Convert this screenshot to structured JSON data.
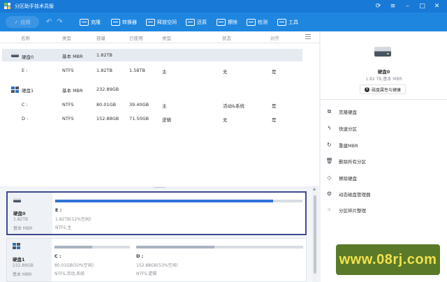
{
  "window": {
    "title": "分区助手技术员版"
  },
  "toolbar": {
    "apply_label": "应用",
    "tools": [
      {
        "label": "克隆",
        "icon": "clone-icon"
      },
      {
        "label": "转换器",
        "icon": "convert-icon"
      },
      {
        "label": "释放空间",
        "icon": "free-space-icon"
      },
      {
        "label": "还原",
        "icon": "restore-icon"
      },
      {
        "label": "擦除",
        "icon": "wipe-icon"
      },
      {
        "label": "检测",
        "icon": "check-icon"
      },
      {
        "label": "工具",
        "icon": "tools-icon"
      }
    ]
  },
  "table": {
    "headers": [
      "名称",
      "类型",
      "容量",
      "已使用",
      "类型",
      "状态",
      "对齐"
    ],
    "rows": [
      {
        "kind": "disk",
        "name": "硬盘0",
        "type": "基本 MBR",
        "capacity": "1.82TB",
        "used": "",
        "ptype": "",
        "status": "",
        "align": "",
        "selected": true
      },
      {
        "kind": "part",
        "name": "E :",
        "type": "NTFS",
        "capacity": "1.82TB",
        "used": "1.58TB",
        "ptype": "主",
        "status": "无",
        "align": "是"
      },
      {
        "kind": "disk2",
        "name": "硬盘1",
        "type": "基本 MBR",
        "capacity": "232.89GB",
        "used": "",
        "ptype": "",
        "status": "",
        "align": ""
      },
      {
        "kind": "part",
        "name": "C :",
        "type": "NTFS",
        "capacity": "80.01GB",
        "used": "39.40GB",
        "ptype": "主",
        "status": "活动&系统",
        "align": "是"
      },
      {
        "kind": "part",
        "name": "D :",
        "type": "NTFS",
        "capacity": "152.88GB",
        "used": "71.50GB",
        "ptype": "逻辑",
        "status": "无",
        "align": "是"
      }
    ]
  },
  "diskmap": {
    "disk0": {
      "name": "硬盘0",
      "size": "1.82TB",
      "type": "基本 MBR",
      "partitions": [
        {
          "label": "E :",
          "info1": "1.82TB(12%空闲)",
          "info2": "NTFS,主",
          "used_fraction": 0.88
        }
      ]
    },
    "disk1": {
      "name": "硬盘1",
      "size": "232.89GB",
      "type": "基本 MBR",
      "partitions": [
        {
          "label": "C :",
          "info1": "80.01GB(50%空闲)",
          "info2": "NTFS,活动,系统",
          "used_fraction": 0.5
        },
        {
          "label": "D :",
          "info1": "152.88GB(53%空闲)",
          "info2": "NTFS,逻辑",
          "used_fraction": 0.47
        }
      ]
    }
  },
  "sidebar": {
    "disk_name": "硬盘0",
    "disk_sub": "1.82 TB,基本 MBR",
    "props_button": "磁盘属性与健康",
    "actions": [
      {
        "label": "克隆硬盘",
        "icon": "clone-disk-icon"
      },
      {
        "label": "快速分区",
        "icon": "quick-partition-icon"
      },
      {
        "label": "重建MBR",
        "icon": "rebuild-mbr-icon"
      },
      {
        "label": "删除所有分区",
        "icon": "delete-icon"
      },
      {
        "label": "擦除硬盘",
        "icon": "eraser-icon"
      },
      {
        "label": "动态磁盘管理器",
        "icon": "dynamic-disk-icon"
      },
      {
        "label": "分区碎片整理",
        "icon": "defrag-icon"
      }
    ]
  },
  "watermark": {
    "text": "www.08rj.com"
  },
  "colors": {
    "titlebar": "#1979d6",
    "toolbar": "#1f86df",
    "accent_bar": "#2f72d6",
    "selection": "#e6ebf2",
    "watermark_bg": "#5a7a2a",
    "watermark_text": "#f2e24b"
  }
}
